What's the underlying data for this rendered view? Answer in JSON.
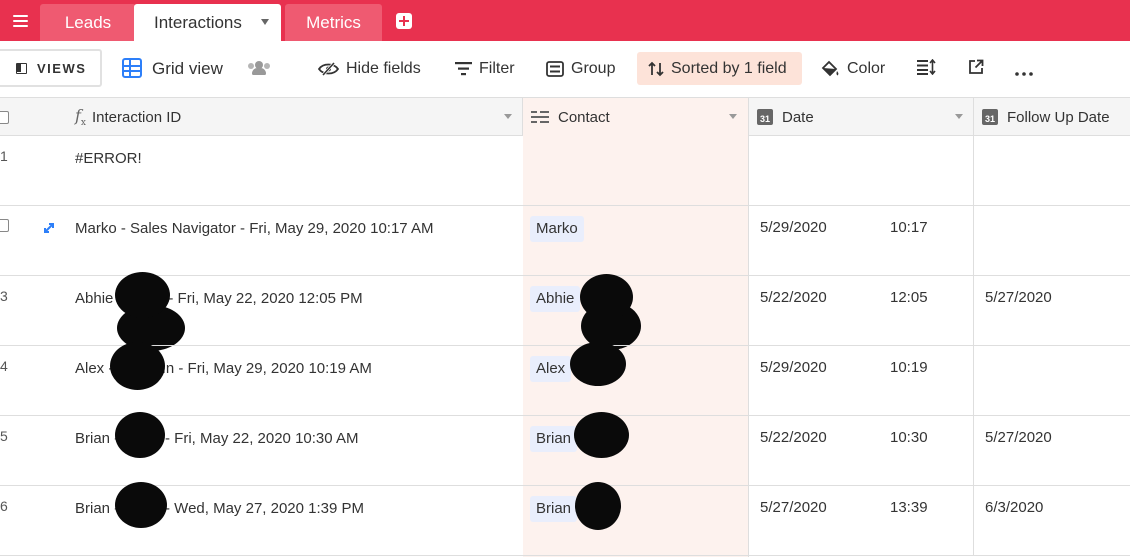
{
  "tabs": [
    {
      "label": "Leads"
    },
    {
      "label": "Interactions"
    },
    {
      "label": "Metrics"
    }
  ],
  "toolbar": {
    "views_label": "VIEWS",
    "view_name": "Grid view",
    "hide_fields": "Hide fields",
    "filter": "Filter",
    "group": "Group",
    "sort": "Sorted by 1 field",
    "color": "Color",
    "more": "•••"
  },
  "columns": {
    "id": "Interaction ID",
    "contact": "Contact",
    "date": "Date",
    "follow_up": "Follow Up Date",
    "date_icon_text": "31"
  },
  "rows": [
    {
      "num": "1",
      "id": "#ERROR!",
      "contact": "",
      "date": "",
      "time": "",
      "follow": ""
    },
    {
      "num": "",
      "id": " Marko              - Sales Navigator - Fri, May 29, 2020 10:17 AM",
      "contact": "Marko",
      "date": "5/29/2020",
      "time": "10:17",
      "follow": ""
    },
    {
      "num": "3",
      "id": "Abhie              - Email - Fri, May 22, 2020 12:05 PM",
      "contact": "Abhie",
      "date": "5/22/2020",
      "time": "12:05",
      "follow": "5/27/2020"
    },
    {
      "num": "4",
      "id": "Alex              - LinkedIn - Fri, May 29, 2020 10:19 AM",
      "contact": "Alex",
      "date": "5/29/2020",
      "time": "10:19",
      "follow": ""
    },
    {
      "num": "5",
      "id": "Brian              - Email - Fri, May 22, 2020 10:30 AM",
      "contact": "Brian",
      "date": "5/22/2020",
      "time": "10:30",
      "follow": "5/27/2020"
    },
    {
      "num": "6",
      "id": "Brian              - Email - Wed, May 27, 2020 1:39 PM",
      "contact": "Brian",
      "date": "5/27/2020",
      "time": "13:39",
      "follow": "6/3/2020"
    }
  ],
  "colors": {
    "brand": "#e8314f",
    "sort_highlight": "#fde3d9",
    "grid_blue": "#2d7ff9",
    "contact_column": "#fdf2ee",
    "chip": "#e9eefc"
  }
}
